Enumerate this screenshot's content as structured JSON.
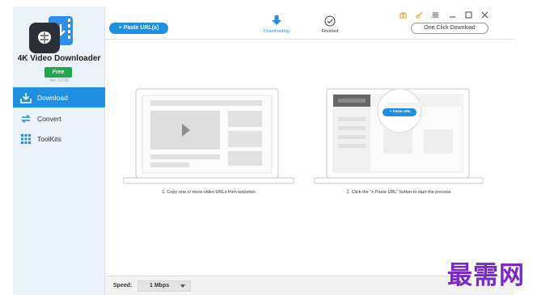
{
  "app": {
    "name": "4K Video Downloader",
    "edition": "Free",
    "version": "Ver: 3.2.06"
  },
  "sidebar": {
    "items": [
      {
        "label": "Download",
        "icon": "download-icon",
        "active": true
      },
      {
        "label": "Convert",
        "icon": "convert-icon",
        "active": false
      },
      {
        "label": "ToolKits",
        "icon": "grid-icon",
        "active": false
      }
    ]
  },
  "toolbar": {
    "paste_label": "+ Paste URL(s)",
    "tabs": [
      {
        "label": "Downloading",
        "icon": "download-arrow-icon",
        "active": true
      },
      {
        "label": "Finished",
        "icon": "check-circle-icon",
        "active": false
      }
    ],
    "one_click_label": "One Click Download"
  },
  "window_controls": {
    "icons": [
      "gift-icon",
      "key-icon",
      "menu-icon",
      "minimize-icon",
      "maximize-icon",
      "close-icon"
    ]
  },
  "instructions": {
    "step1": "1. Copy one or more video URLs from websites",
    "step2": "2. Click the \"+ Paste URL\" button to start the process",
    "magnified_button": "+ Paste URL"
  },
  "footer": {
    "speed_label": "Speed:",
    "speed_value": "1 Mbps"
  },
  "watermark": {
    "text": "最需网"
  },
  "colors": {
    "accent": "#1e8fe1",
    "sidebar_bg": "#eaf2fb",
    "free_badge": "#1fa74b",
    "watermark": "#7a28c8",
    "control_orange": "#f29b1d"
  }
}
